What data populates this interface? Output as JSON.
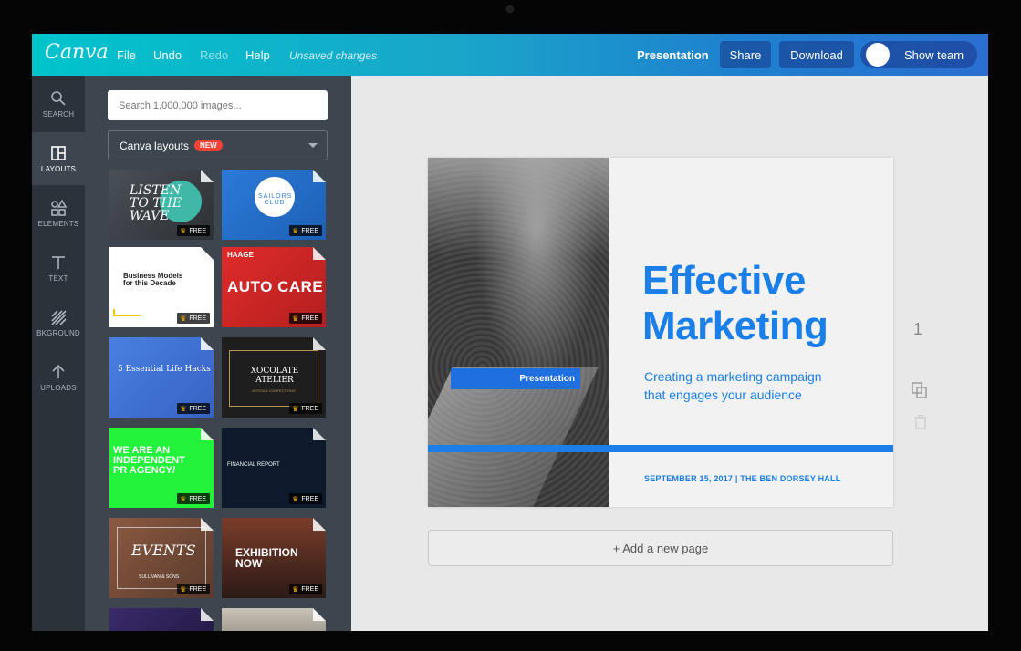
{
  "app": {
    "logo": "Canva",
    "menu": {
      "file": "File",
      "undo": "Undo",
      "redo": "Redo",
      "help": "Help",
      "status": "Unsaved changes"
    },
    "doc_type": "Presentation",
    "share_label": "Share",
    "download_label": "Download",
    "team_label": "Show team"
  },
  "rail": [
    {
      "label": "SEARCH",
      "icon": "search-icon"
    },
    {
      "label": "LAYOUTS",
      "icon": "layouts-icon",
      "active": true
    },
    {
      "label": "ELEMENTS",
      "icon": "elements-icon"
    },
    {
      "label": "TEXT",
      "icon": "text-icon"
    },
    {
      "label": "BKGROUND",
      "icon": "background-icon"
    },
    {
      "label": "UPLOADS",
      "icon": "upload-icon"
    }
  ],
  "panel": {
    "search_placeholder": "Search 1,000,000 images...",
    "filter_label": "Canva layouts",
    "filter_badge": "NEW",
    "free_label": "FREE",
    "templates": [
      {
        "title": "LISTEN TO THE WAVE"
      },
      {
        "title": "SAILORS CLUB"
      },
      {
        "title": "Business Models for this Decade"
      },
      {
        "title": "AUTO CARE",
        "subtitle": "HAAGE"
      },
      {
        "title": "5 Essential Life Hacks"
      },
      {
        "title": "XOCOLATE ATELIER",
        "subtitle": "ARTISAN CONFECTIONS"
      },
      {
        "title": "WE ARE AN INDEPENDENT PR AGENCY/"
      },
      {
        "title": "FINANCIAL REPORT"
      },
      {
        "title": "EVENTS",
        "subtitle": "SULLIVAN & SONS"
      },
      {
        "title": "EXHIBITION NOW"
      }
    ]
  },
  "slide": {
    "tag": "Presentation",
    "title_line1": "Effective",
    "title_line2": "Marketing",
    "subtitle_line1": "Creating a marketing campaign",
    "subtitle_line2": "that engages your audience",
    "footer": "SEPTEMBER 15, 2017  |  THE BEN DORSEY HALL",
    "accent": "#1a7fe8"
  },
  "page_number": "1",
  "add_page_label": "+ Add a new page"
}
